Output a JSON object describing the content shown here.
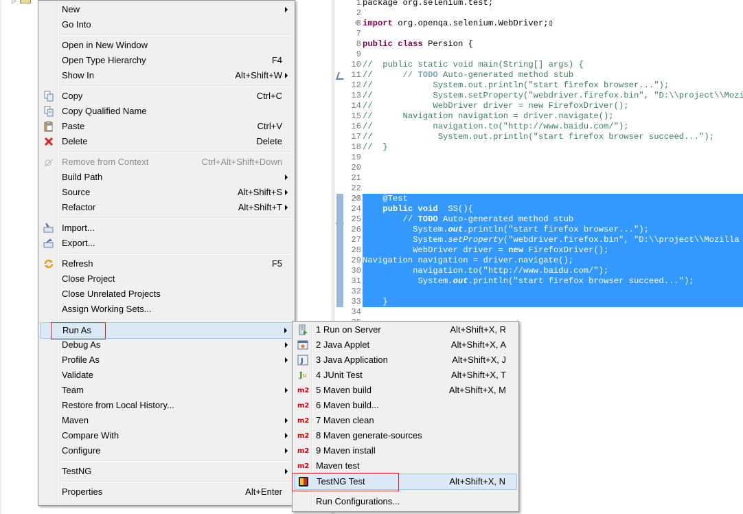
{
  "editor": {
    "lines": [
      {
        "n": "1",
        "parts": [
          {
            "t": "package org.selenium.test;",
            "c": "plain"
          }
        ]
      },
      {
        "n": "2",
        "parts": []
      },
      {
        "n": "3",
        "fold": "⊕",
        "parts": [
          {
            "t": "import",
            "c": "kw"
          },
          {
            "t": " org.openqa.selenium.WebDriver;",
            "c": "plain"
          },
          {
            "t": "▯",
            "c": "plain"
          }
        ]
      },
      {
        "n": "7",
        "parts": []
      },
      {
        "n": "8",
        "parts": [
          {
            "t": "public",
            "c": "kw"
          },
          {
            "t": " ",
            "c": "plain"
          },
          {
            "t": "class",
            "c": "kw"
          },
          {
            "t": " Persion {",
            "c": "plain"
          }
        ]
      },
      {
        "n": "9",
        "parts": []
      },
      {
        "n": "10",
        "parts": [
          {
            "t": "//  public static void main(String[] args) {",
            "c": "cm"
          }
        ]
      },
      {
        "n": "11",
        "parts": [
          {
            "t": "//      ",
            "c": "cm"
          },
          {
            "t": "// TODO",
            "c": "cmk"
          },
          {
            "t": " Auto-generated method stub",
            "c": "cm"
          }
        ]
      },
      {
        "n": "12",
        "parts": [
          {
            "t": "//            System.out.println(\"start firefox browser...\");",
            "c": "cm"
          }
        ]
      },
      {
        "n": "13",
        "parts": [
          {
            "t": "//            System.setProperty(\"webdriver.firefox.bin\", \"D:\\\\project\\\\Mozilla",
            "c": "cm"
          }
        ]
      },
      {
        "n": "14",
        "parts": [
          {
            "t": "//            WebDriver driver = new FirefoxDriver();",
            "c": "cm"
          }
        ]
      },
      {
        "n": "15",
        "parts": [
          {
            "t": "//      Navigation navigation = driver.navigate();",
            "c": "cm"
          }
        ]
      },
      {
        "n": "16",
        "parts": [
          {
            "t": "//            navigation.to(\"http://www.baidu.com/\");",
            "c": "cm"
          }
        ]
      },
      {
        "n": "17",
        "parts": [
          {
            "t": "//             System.out.println(\"start firefox browser succeed...\");",
            "c": "cm"
          }
        ]
      },
      {
        "n": "18",
        "parts": [
          {
            "t": "//  }",
            "c": "cm"
          }
        ]
      },
      {
        "n": "19",
        "parts": []
      },
      {
        "n": "20",
        "parts": []
      },
      {
        "n": "21",
        "parts": []
      },
      {
        "n": "22",
        "parts": []
      },
      {
        "n": "23",
        "sel": true,
        "fold": "⊖",
        "parts": [
          {
            "t": "    @Test",
            "c": "plain"
          }
        ]
      },
      {
        "n": "24",
        "sel": true,
        "parts": [
          {
            "t": "    ",
            "c": "plain"
          },
          {
            "t": "public",
            "c": "kw"
          },
          {
            "t": " ",
            "c": "plain"
          },
          {
            "t": "void",
            "c": "kw"
          },
          {
            "t": "  SS(){",
            "c": "plain"
          }
        ]
      },
      {
        "n": "25",
        "sel": true,
        "parts": [
          {
            "t": "        // ",
            "c": "cm"
          },
          {
            "t": "TODO",
            "c": "kw"
          },
          {
            "t": " Auto-generated method stub",
            "c": "cm"
          }
        ]
      },
      {
        "n": "26",
        "sel": true,
        "parts": [
          {
            "t": "          System.",
            "c": "plain"
          },
          {
            "t": "out",
            "c": "kw it"
          },
          {
            "t": ".println(\"start firefox browser...\");",
            "c": "plain"
          }
        ]
      },
      {
        "n": "27",
        "sel": true,
        "parts": [
          {
            "t": "          System.",
            "c": "plain"
          },
          {
            "t": "setProperty",
            "c": "it"
          },
          {
            "t": "(\"webdriver.firefox.bin\", \"D:\\\\project\\\\Mozilla Fir",
            "c": "plain"
          }
        ]
      },
      {
        "n": "28",
        "sel": true,
        "parts": [
          {
            "t": "          WebDriver driver = ",
            "c": "plain"
          },
          {
            "t": "new",
            "c": "kw"
          },
          {
            "t": " FirefoxDriver();",
            "c": "plain"
          }
        ]
      },
      {
        "n": "29",
        "sel": true,
        "parts": [
          {
            "t": "Navigation navigation = driver.navigate();",
            "c": "plain"
          }
        ]
      },
      {
        "n": "30",
        "sel": true,
        "parts": [
          {
            "t": "          navigation.to(\"http://www.baidu.com/\");",
            "c": "plain"
          }
        ]
      },
      {
        "n": "31",
        "sel": true,
        "parts": [
          {
            "t": "           System.",
            "c": "plain"
          },
          {
            "t": "out",
            "c": "kw it"
          },
          {
            "t": ".println(\"start firefox browser succeed...\");",
            "c": "plain"
          }
        ]
      },
      {
        "n": "32",
        "sel": true,
        "parts": []
      },
      {
        "n": "33",
        "sel": true,
        "parts": [
          {
            "t": "    }",
            "c": "plain"
          }
        ]
      },
      {
        "n": "34",
        "parts": []
      },
      {
        "n": "35",
        "parts": []
      }
    ]
  },
  "context_menu": {
    "items": [
      {
        "type": "item",
        "name": "menu-new",
        "label": "New",
        "submenu": true
      },
      {
        "type": "item",
        "name": "menu-go-into",
        "label": "Go Into"
      },
      {
        "type": "sep"
      },
      {
        "type": "item",
        "name": "menu-open-in-new-window",
        "label": "Open in New Window"
      },
      {
        "type": "item",
        "name": "menu-open-type-hierarchy",
        "label": "Open Type Hierarchy",
        "shortcut": "F4"
      },
      {
        "type": "item",
        "name": "menu-show-in",
        "label": "Show In",
        "shortcut": "Alt+Shift+W",
        "submenu": true
      },
      {
        "type": "sep"
      },
      {
        "type": "item",
        "name": "menu-copy",
        "label": "Copy",
        "shortcut": "Ctrl+C",
        "icon": "copy-icon"
      },
      {
        "type": "item",
        "name": "menu-copy-qualified-name",
        "label": "Copy Qualified Name",
        "icon": "copy-qualified-name-icon"
      },
      {
        "type": "item",
        "name": "menu-paste",
        "label": "Paste",
        "shortcut": "Ctrl+V",
        "icon": "paste-icon"
      },
      {
        "type": "item",
        "name": "menu-delete",
        "label": "Delete",
        "shortcut": "Delete",
        "icon": "delete-icon"
      },
      {
        "type": "sep"
      },
      {
        "type": "item",
        "name": "menu-remove-from-context",
        "label": "Remove from Context",
        "shortcut": "Ctrl+Alt+Shift+Down",
        "icon": "remove-context-icon",
        "disabled": true
      },
      {
        "type": "item",
        "name": "menu-build-path",
        "label": "Build Path",
        "submenu": true
      },
      {
        "type": "item",
        "name": "menu-source",
        "label": "Source",
        "shortcut": "Alt+Shift+S",
        "submenu": true
      },
      {
        "type": "item",
        "name": "menu-refactor",
        "label": "Refactor",
        "shortcut": "Alt+Shift+T",
        "submenu": true
      },
      {
        "type": "sep"
      },
      {
        "type": "item",
        "name": "menu-import",
        "label": "Import...",
        "icon": "import-icon"
      },
      {
        "type": "item",
        "name": "menu-export",
        "label": "Export...",
        "icon": "export-icon"
      },
      {
        "type": "sep"
      },
      {
        "type": "item",
        "name": "menu-refresh",
        "label": "Refresh",
        "shortcut": "F5",
        "icon": "refresh-icon"
      },
      {
        "type": "item",
        "name": "menu-close-project",
        "label": "Close Project"
      },
      {
        "type": "item",
        "name": "menu-close-unrelated-projects",
        "label": "Close Unrelated Projects"
      },
      {
        "type": "item",
        "name": "menu-assign-working-sets",
        "label": "Assign Working Sets..."
      },
      {
        "type": "sep"
      },
      {
        "type": "item",
        "name": "menu-run-as",
        "label": "Run As",
        "submenu": true,
        "active": true
      },
      {
        "type": "item",
        "name": "menu-debug-as",
        "label": "Debug As",
        "submenu": true
      },
      {
        "type": "item",
        "name": "menu-profile-as",
        "label": "Profile As",
        "submenu": true
      },
      {
        "type": "item",
        "name": "menu-validate",
        "label": "Validate"
      },
      {
        "type": "item",
        "name": "menu-team",
        "label": "Team",
        "submenu": true
      },
      {
        "type": "item",
        "name": "menu-restore-from-local-history",
        "label": "Restore from Local History..."
      },
      {
        "type": "item",
        "name": "menu-maven",
        "label": "Maven",
        "submenu": true
      },
      {
        "type": "item",
        "name": "menu-compare-with",
        "label": "Compare With",
        "submenu": true
      },
      {
        "type": "item",
        "name": "menu-configure",
        "label": "Configure",
        "submenu": true
      },
      {
        "type": "sep"
      },
      {
        "type": "item",
        "name": "menu-testng",
        "label": "TestNG",
        "submenu": true
      },
      {
        "type": "sep"
      },
      {
        "type": "item",
        "name": "menu-properties",
        "label": "Properties",
        "shortcut": "Alt+Enter"
      }
    ]
  },
  "run_as_menu": {
    "items": [
      {
        "type": "item",
        "name": "runas-run-on-server",
        "label": "1 Run on Server",
        "shortcut": "Alt+Shift+X, R",
        "icon": "server-run-icon"
      },
      {
        "type": "item",
        "name": "runas-java-applet",
        "label": "2 Java Applet",
        "shortcut": "Alt+Shift+X, A",
        "icon": "java-applet-icon"
      },
      {
        "type": "item",
        "name": "runas-java-application",
        "label": "3 Java Application",
        "shortcut": "Alt+Shift+X, J",
        "icon": "java-application-icon"
      },
      {
        "type": "item",
        "name": "runas-junit-test",
        "label": "4 JUnit Test",
        "shortcut": "Alt+Shift+X, T",
        "icon": "junit-icon",
        "glyph": "Ju"
      },
      {
        "type": "item",
        "name": "runas-maven-build",
        "label": "5 Maven build",
        "shortcut": "Alt+Shift+X, M",
        "icon": "maven-icon",
        "glyph": "m2"
      },
      {
        "type": "item",
        "name": "runas-maven-build-dots",
        "label": "6 Maven build...",
        "icon": "maven-icon",
        "glyph": "m2"
      },
      {
        "type": "item",
        "name": "runas-maven-clean",
        "label": "7 Maven clean",
        "icon": "maven-icon",
        "glyph": "m2"
      },
      {
        "type": "item",
        "name": "runas-maven-generate-sources",
        "label": "8 Maven generate-sources",
        "icon": "maven-icon",
        "glyph": "m2"
      },
      {
        "type": "item",
        "name": "runas-maven-install",
        "label": "9 Maven install",
        "icon": "maven-icon",
        "glyph": "m2"
      },
      {
        "type": "item",
        "name": "runas-maven-test",
        "label": "Maven test",
        "icon": "maven-icon",
        "glyph": "m2"
      },
      {
        "type": "item",
        "name": "runas-testng-test",
        "label": "TestNG Test",
        "shortcut": "Alt+Shift+X, N",
        "icon": "testng-icon",
        "active": true
      },
      {
        "type": "sep"
      },
      {
        "type": "item",
        "name": "runas-run-configurations",
        "label": "Run Configurations..."
      }
    ]
  }
}
